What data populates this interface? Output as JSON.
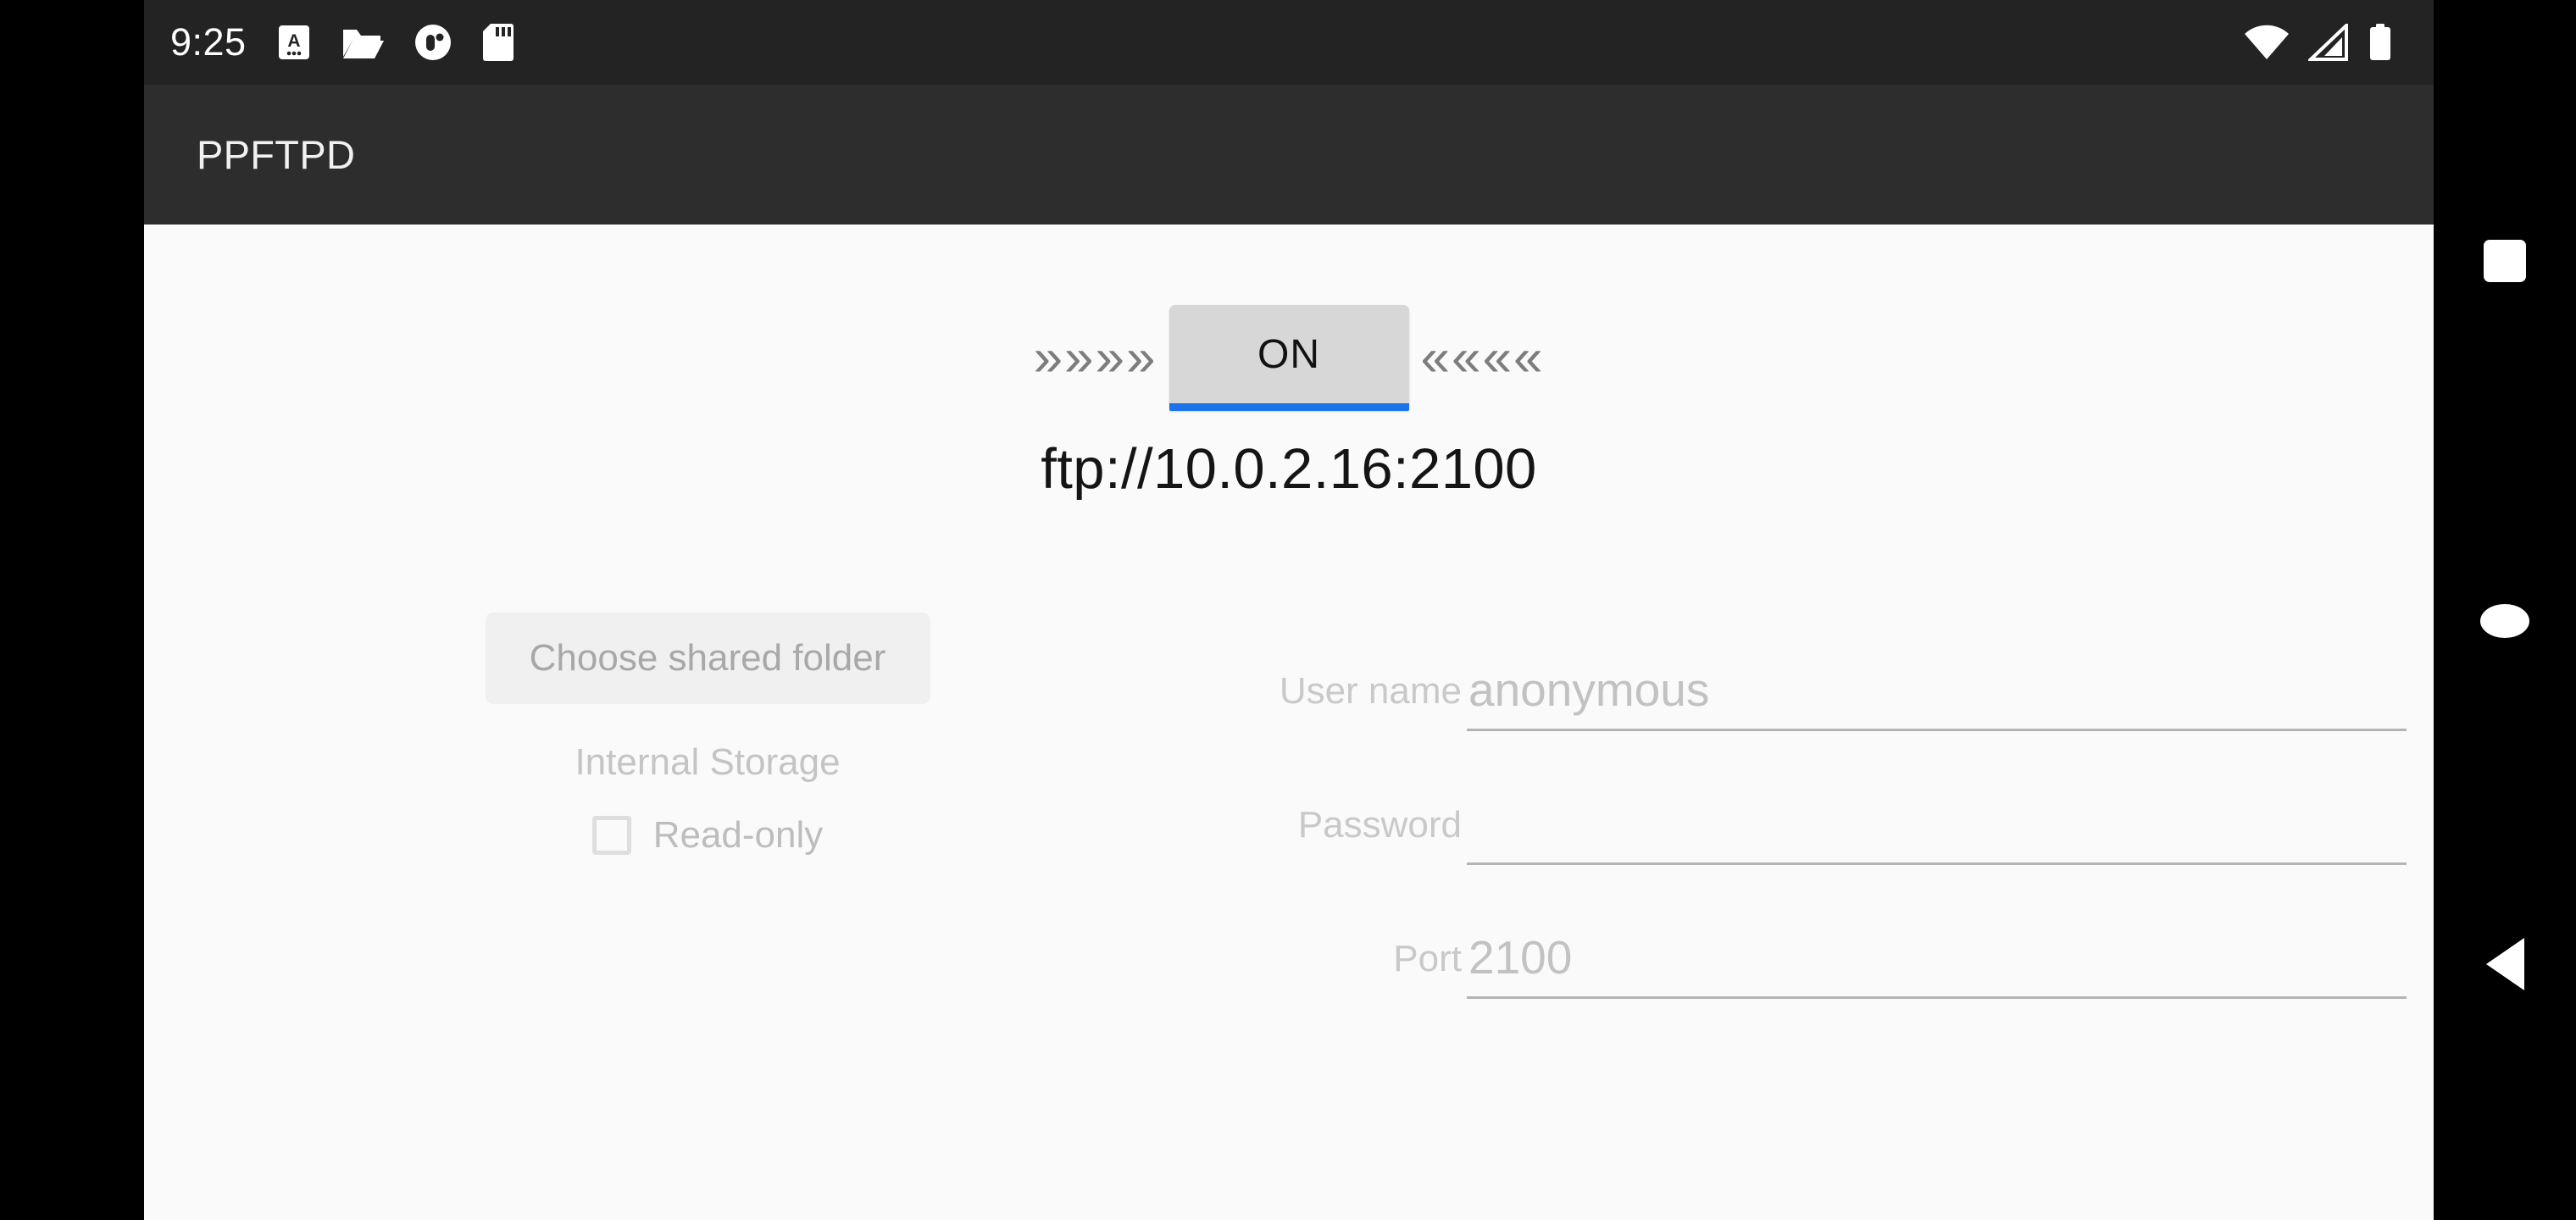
{
  "status_bar": {
    "clock": "9:25",
    "notification_icons": [
      "keyboard-input-icon",
      "folder-open-icon",
      "app-circle-icon",
      "sd-card-icon"
    ],
    "system_icons": [
      "wifi-icon",
      "cellular-signal-icon",
      "battery-icon"
    ],
    "background_color": "#232323"
  },
  "app_bar": {
    "title": "PPFTPD",
    "background_color": "#2d2d2d",
    "title_color": "#f1f1f1"
  },
  "server": {
    "left_chevrons": "»»»»",
    "right_chevrons": "««««",
    "toggle_label": "ON",
    "toggle_state": "on",
    "toggle_accent_color": "#1a73e8",
    "toggle_background_color": "#d7d7d7",
    "url": "ftp://10.0.2.16:2100"
  },
  "share": {
    "choose_folder_label": "Choose shared folder",
    "storage_label": "Internal Storage",
    "readonly_label": "Read-only",
    "readonly_checked": false
  },
  "credentials": {
    "fields": [
      {
        "label": "User name",
        "value": "anonymous",
        "placeholder": ""
      },
      {
        "label": "Password",
        "value": "",
        "placeholder": ""
      },
      {
        "label": "Port",
        "value": "2100",
        "placeholder": ""
      }
    ]
  },
  "nav_bar": {
    "recents_label": "Overview",
    "home_label": "Home",
    "back_label": "Back",
    "background_color": "#000000"
  }
}
